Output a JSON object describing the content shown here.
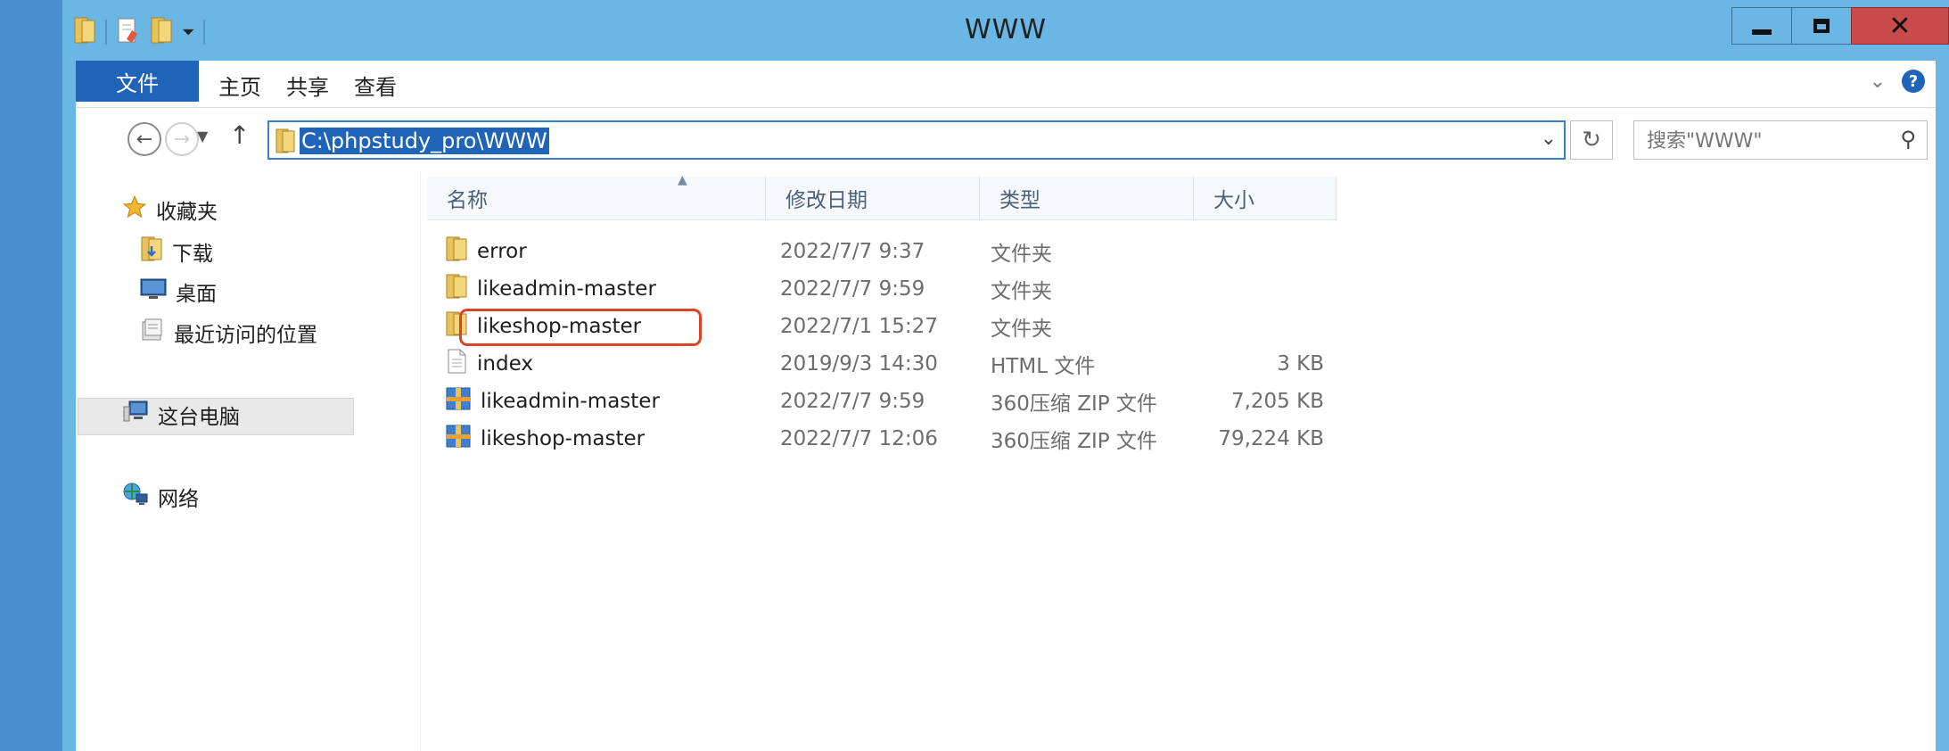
{
  "window": {
    "title": "WWW"
  },
  "ribbon": {
    "tabs": [
      {
        "label": "文件"
      },
      {
        "label": "主页"
      },
      {
        "label": "共享"
      },
      {
        "label": "查看"
      }
    ],
    "help": "?"
  },
  "address": {
    "path": "C:\\phpstudy_pro\\WWW",
    "search_placeholder": "搜索\"WWW\""
  },
  "nav_pane": {
    "favorites": "收藏夹",
    "downloads": "下载",
    "desktop": "桌面",
    "recent": "最近访问的位置",
    "this_pc": "这台电脑",
    "network": "网络"
  },
  "columns": {
    "name": "名称",
    "date": "修改日期",
    "type": "类型",
    "size": "大小"
  },
  "files": [
    {
      "name": "error",
      "date": "2022/7/7 9:37",
      "type": "文件夹",
      "size": "",
      "icon": "folder-icon"
    },
    {
      "name": "likeadmin-master",
      "date": "2022/7/7 9:59",
      "type": "文件夹",
      "size": "",
      "icon": "folder-icon"
    },
    {
      "name": "likeshop-master",
      "date": "2022/7/1 15:27",
      "type": "文件夹",
      "size": "",
      "icon": "folder-icon"
    },
    {
      "name": "index",
      "date": "2019/9/3 14:30",
      "type": "HTML 文件",
      "size": "3 KB",
      "icon": "document-icon"
    },
    {
      "name": "likeadmin-master",
      "date": "2022/7/7 9:59",
      "type": "360压缩 ZIP 文件",
      "size": "7,205 KB",
      "icon": "zip-icon"
    },
    {
      "name": "likeshop-master",
      "date": "2022/7/7 12:06",
      "type": "360压缩 ZIP 文件",
      "size": "79,224 KB",
      "icon": "zip-icon"
    }
  ],
  "colors": {
    "titlebar": "#6ab6e4",
    "file_tab": "#1f64b8",
    "selection": "#1f64b8",
    "highlight_annotation": "#d8452a",
    "close_button": "#c94b4b"
  }
}
